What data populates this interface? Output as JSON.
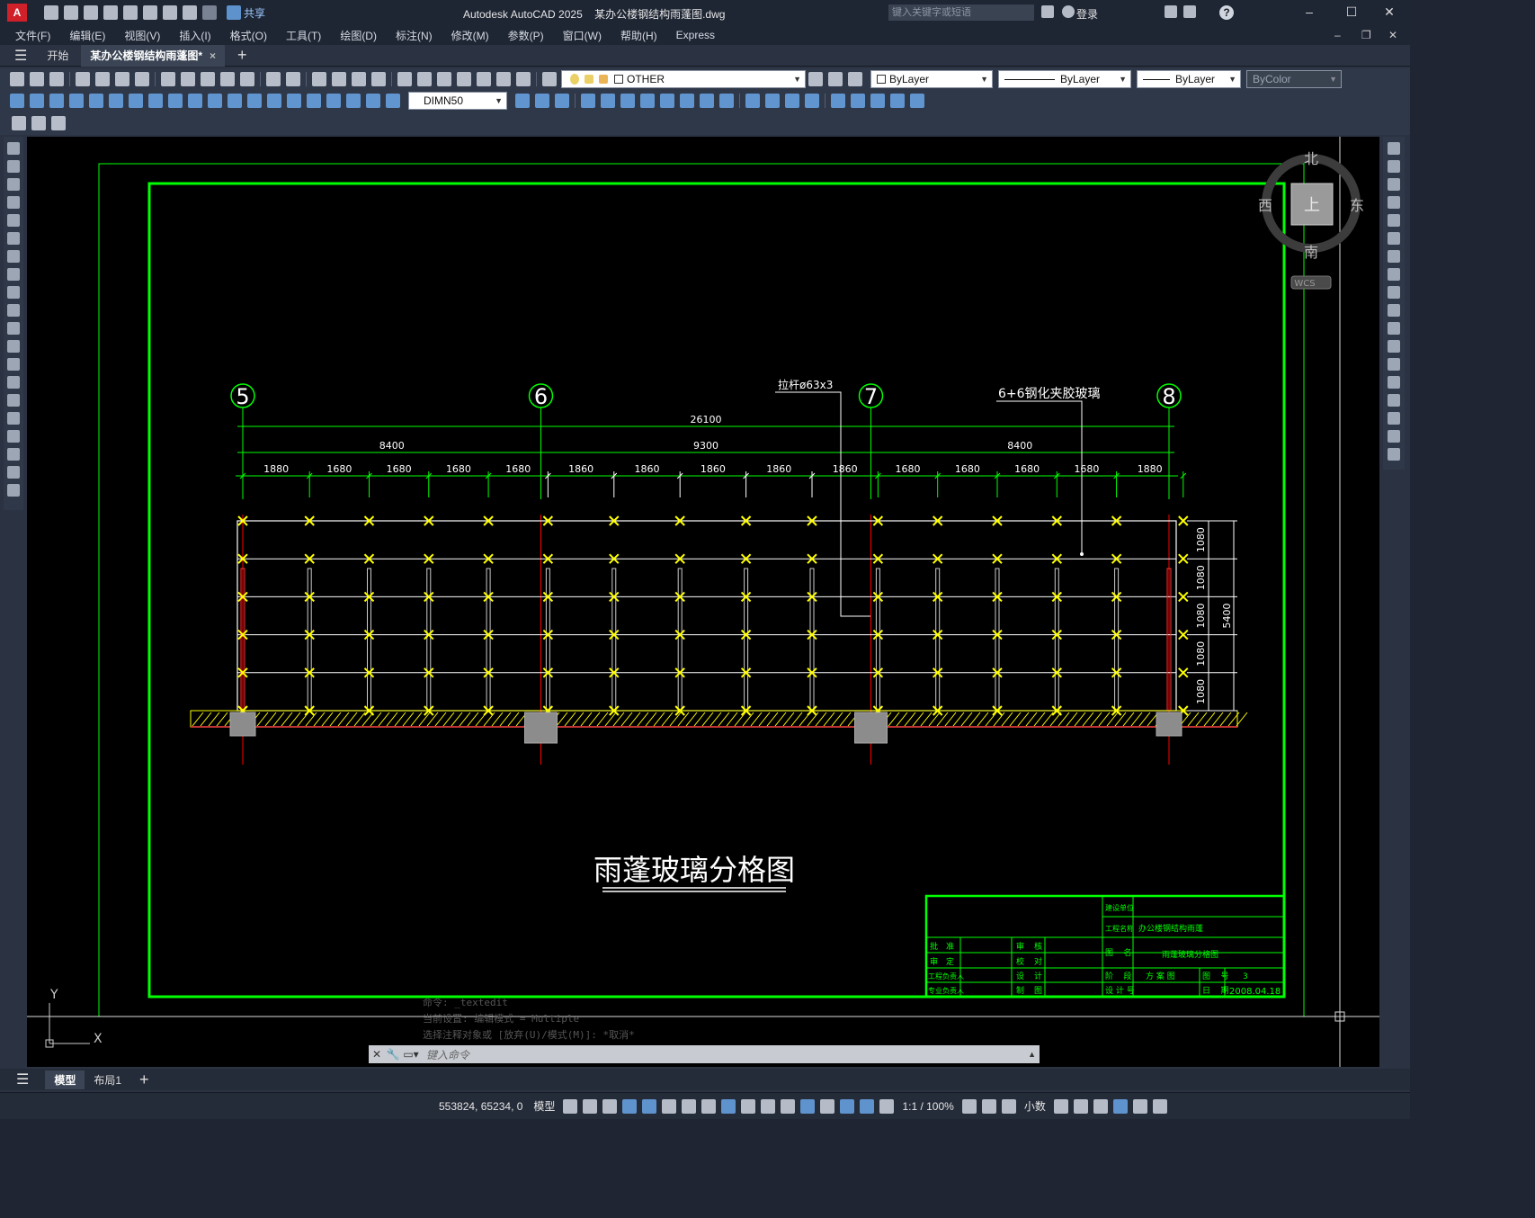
{
  "titlebar": {
    "app_icon": "A",
    "share": "共享",
    "title": "Autodesk AutoCAD 2025    某办公楼钢结构雨蓬图.dwg",
    "search_placeholder": "键入关键字或短语",
    "login": "登录",
    "help": "?"
  },
  "menus": [
    "文件(F)",
    "编辑(E)",
    "视图(V)",
    "插入(I)",
    "格式(O)",
    "工具(T)",
    "绘图(D)",
    "标注(N)",
    "修改(M)",
    "参数(P)",
    "窗口(W)",
    "帮助(H)",
    "Express"
  ],
  "tabs": {
    "start": "开始",
    "active": "某办公楼钢结构雨蓬图*"
  },
  "toolbar": {
    "layer": "OTHER",
    "color": "ByLayer",
    "linetype": "ByLayer",
    "lineweight": "ByLayer",
    "plotstyle": "ByColor",
    "dimstyle": "DIMN50"
  },
  "viewcube": {
    "north": "北",
    "south": "南",
    "east": "东",
    "west": "西",
    "top": "上",
    "wcs": "WCS"
  },
  "drawing": {
    "axes": [
      "5",
      "6",
      "7",
      "8"
    ],
    "total": "26100",
    "spans": [
      "8400",
      "9300",
      "8400"
    ],
    "subspans": [
      "1880",
      "1680",
      "1680",
      "1680",
      "1680",
      "1860",
      "1860",
      "1860",
      "1860",
      "1860",
      "1680",
      "1680",
      "1680",
      "1680",
      "1880"
    ],
    "heights": [
      "1080",
      "1080",
      "1080",
      "1080",
      "1080"
    ],
    "height_total": "5400",
    "label_rod": "拉杆ø63x3",
    "label_glass": "6+6钢化夹胶玻璃",
    "title": "雨蓬玻璃分格图",
    "title_block": {
      "c1": [
        "批",
        "准",
        "审",
        "定",
        "工程负责人",
        "专业负责人"
      ],
      "c2": [
        "审",
        "核",
        "校",
        "对",
        "设",
        "计",
        "制",
        "图"
      ],
      "build_unit": "建设单位",
      "proj_name_label": "工程名称",
      "proj_name": "办公楼钢结构雨蓬",
      "fig_name_label": "图    名",
      "fig_name": "雨蓬玻璃分格图",
      "stage_label": "阶    段",
      "stage": "方 案 图",
      "figno_label": "图    号",
      "figno": "3",
      "designer_label": "设 计 号",
      "date_label": "日    期",
      "date": "2008.04.18"
    }
  },
  "command": {
    "hist": [
      "命令: _textedit",
      "当前设置: 编辑模式 = Multiple",
      "选择注释对象或 [放弃(U)/模式(M)]: *取消*"
    ],
    "placeholder": "键入命令"
  },
  "layout_tabs": [
    "模型",
    "布局1"
  ],
  "status": {
    "coords": "553824, 65234, 0",
    "model": "模型",
    "scale": "1:1 / 100%",
    "units": "小数"
  },
  "colors": {
    "frame_green": "#00ff00",
    "glass_white": "#ffffff",
    "node_yellow": "#ffff00",
    "axis_red": "#ff0000"
  }
}
